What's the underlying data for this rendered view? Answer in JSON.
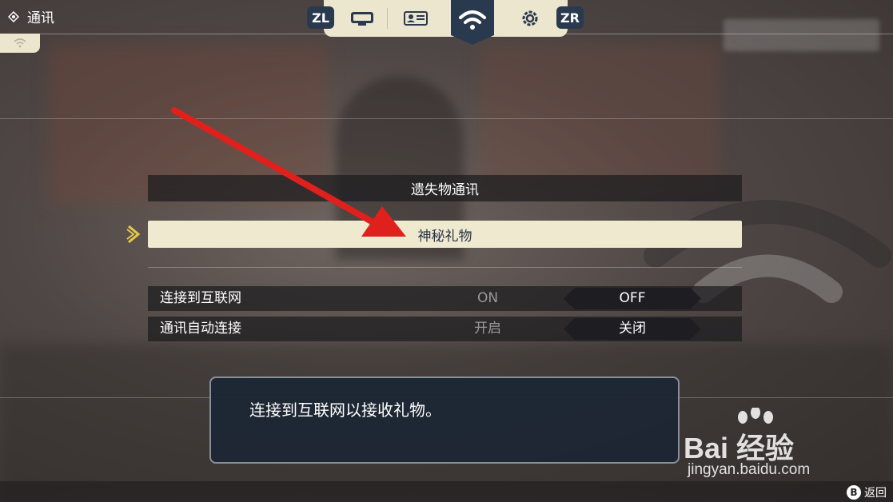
{
  "header": {
    "title": "通讯",
    "tabs": {
      "left_shoulder": "ZL",
      "right_shoulder": "ZR",
      "items": [
        "display-icon",
        "profile-card-icon",
        "wifi-icon",
        "settings-icon"
      ],
      "active": "wifi-icon"
    }
  },
  "menu": {
    "items": [
      "遗失物通讯",
      "神秘礼物"
    ],
    "selected_index": 1
  },
  "settings": [
    {
      "label": "连接到互联网",
      "option_left": "ON",
      "option_right": "OFF",
      "selected": "OFF"
    },
    {
      "label": "通讯自动连接",
      "option_left": "开启",
      "option_right": "关闭",
      "selected": "关闭"
    }
  ],
  "message": "连接到互联网以接收礼物。",
  "footer": {
    "back_button": "B",
    "back_label": "返回"
  },
  "watermark": {
    "brand": "Bai 经验",
    "url": "jingyan.baidu.com"
  },
  "colors": {
    "panel_cream": "#efe9cf",
    "navy": "#2a3a4e",
    "arrow_red": "#e0201c"
  }
}
